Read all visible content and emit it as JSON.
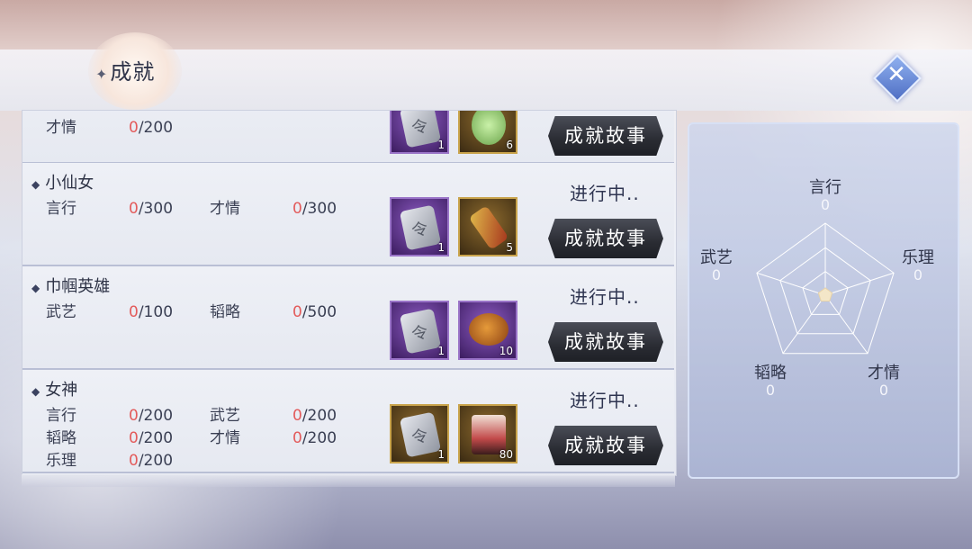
{
  "header": {
    "title": "成就",
    "close_icon": "close-x-icon"
  },
  "achievements": [
    {
      "name": "",
      "partial": true,
      "stats": [
        {
          "label": "才情",
          "current": "0",
          "target": "/200"
        }
      ],
      "rewards": [
        {
          "icon": "token-plate",
          "count": "1"
        },
        {
          "icon": "jade-disc",
          "count": "6"
        }
      ],
      "status": "",
      "button": "成就故事"
    },
    {
      "name": "小仙女",
      "stats": [
        {
          "label": "言行",
          "current": "0",
          "target": "/300"
        },
        {
          "label": "才情",
          "current": "0",
          "target": "/300"
        }
      ],
      "rewards": [
        {
          "icon": "token-plate",
          "count": "1"
        },
        {
          "icon": "scroll",
          "count": "5"
        }
      ],
      "status": "进行中..",
      "button": "成就故事"
    },
    {
      "name": "巾帼英雄",
      "stats": [
        {
          "label": "武艺",
          "current": "0",
          "target": "/100"
        },
        {
          "label": "韬略",
          "current": "0",
          "target": "/500"
        }
      ],
      "rewards": [
        {
          "icon": "token-plate",
          "count": "1"
        },
        {
          "icon": "roast-chicken",
          "count": "10"
        }
      ],
      "status": "进行中..",
      "button": "成就故事"
    },
    {
      "name": "女神",
      "stats": [
        {
          "label": "言行",
          "current": "0",
          "target": "/200"
        },
        {
          "label": "武艺",
          "current": "0",
          "target": "/200"
        },
        {
          "label": "韬略",
          "current": "0",
          "target": "/200"
        },
        {
          "label": "才情",
          "current": "0",
          "target": "/200"
        },
        {
          "label": "乐理",
          "current": "0",
          "target": "/200"
        }
      ],
      "rewards": [
        {
          "icon": "token-plate",
          "count": "1"
        },
        {
          "icon": "portrait-puzzle",
          "count": "80"
        }
      ],
      "status": "进行中..",
      "button": "成就故事"
    }
  ],
  "radar": {
    "axes": [
      {
        "label": "言行",
        "value": "0"
      },
      {
        "label": "乐理",
        "value": "0"
      },
      {
        "label": "才情",
        "value": "0"
      },
      {
        "label": "韬略",
        "value": "0"
      },
      {
        "label": "武艺",
        "value": "0"
      }
    ],
    "max": 100
  },
  "colors": {
    "progress_zero": "#e35b5b",
    "button_dark": "#2a2c33",
    "close_blue": "#4f6fc4"
  }
}
